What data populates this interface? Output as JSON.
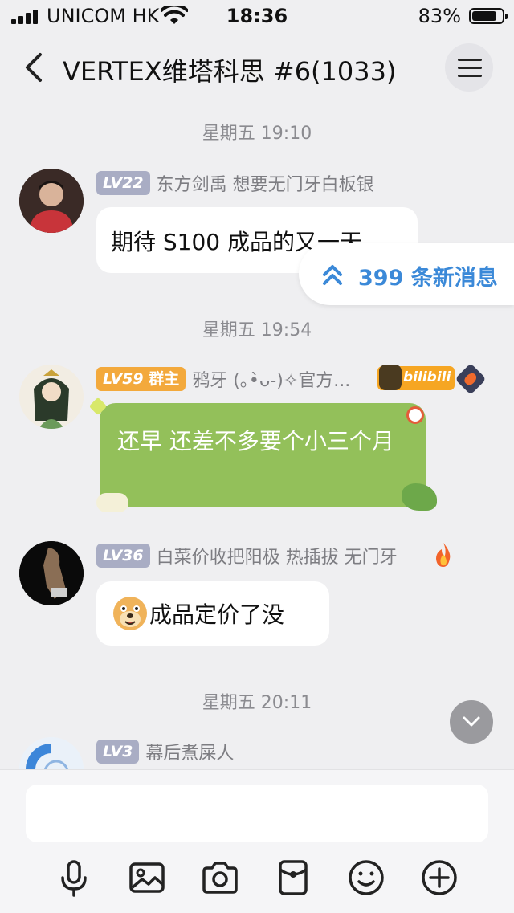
{
  "status_bar": {
    "carrier": "UNICOM HK",
    "time": "18:36",
    "battery": "83%",
    "battery_level": 0.83
  },
  "header": {
    "title": "VERTEX维塔科思 #6(1033)"
  },
  "timestamps": [
    "星期五 19:10",
    "星期五 19:54",
    "星期五 20:11"
  ],
  "new_messages": {
    "label": "399 条新消息"
  },
  "messages": [
    {
      "level": "LV22",
      "name": "东方剑禹 想要无门牙白板银",
      "text": "期待 S100 成品的又一天"
    },
    {
      "level": "LV59",
      "role": "群主",
      "name": "鸦牙 (｡•̀ᴗ-)✧官方...",
      "badge": "bilibili",
      "text": "还早  还差不多要个小三个月"
    },
    {
      "level": "LV36",
      "name": "白菜价收把阳极 热插拔 无门牙",
      "text": "成品定价了没"
    },
    {
      "level": "LV3",
      "name": "幕后煮屎人"
    }
  ],
  "input": {
    "placeholder": ""
  },
  "toolbar": [
    "microphone-icon",
    "image-icon",
    "camera-icon",
    "red-packet-icon",
    "emoji-icon",
    "plus-icon"
  ]
}
